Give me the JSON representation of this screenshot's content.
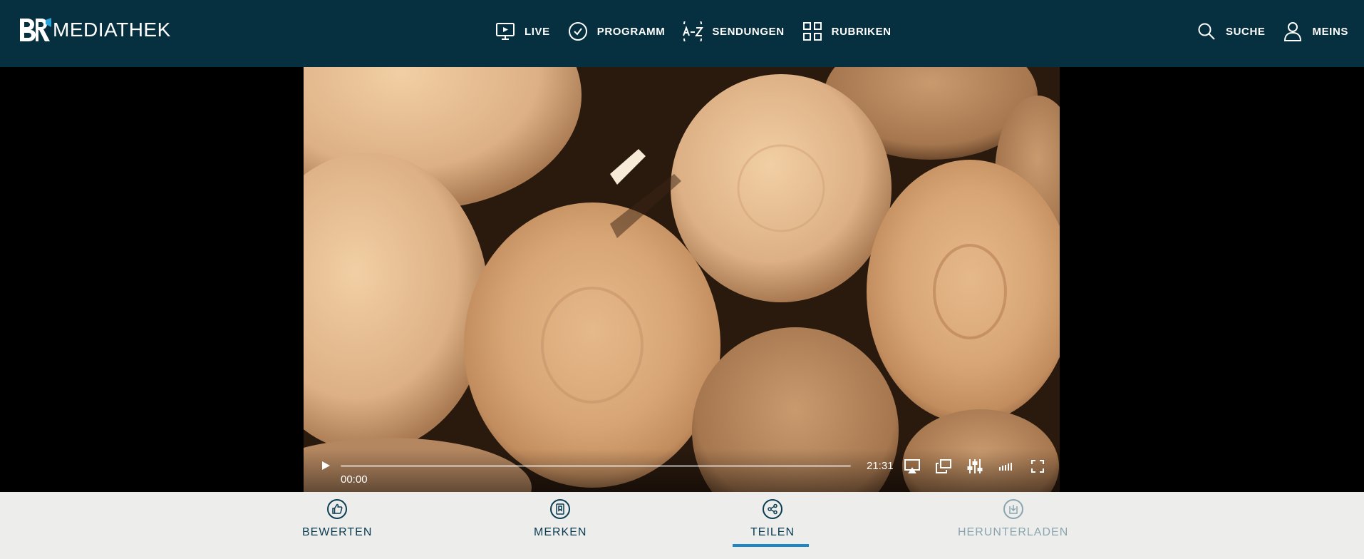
{
  "header": {
    "logo_text": "MEDIATHEK",
    "nav": [
      {
        "label": "LIVE",
        "icon": "live-tv-icon"
      },
      {
        "label": "PROGRAMM",
        "icon": "clock-icon"
      },
      {
        "label": "SENDUNGEN",
        "icon": "a-z-icon"
      },
      {
        "label": "RUBRIKEN",
        "icon": "grid-icon"
      }
    ],
    "search_label": "SUCHE",
    "account_label": "MEINS"
  },
  "player": {
    "current_time": "00:00",
    "duration": "21:31",
    "progress_fraction": 0.0,
    "controls": [
      "play-icon",
      "airplay-icon",
      "picture-in-picture-icon",
      "settings-sliders-icon",
      "volume-icon",
      "fullscreen-icon"
    ]
  },
  "actions": [
    {
      "label": "BEWERTEN",
      "icon": "thumbs-up-icon",
      "enabled": true
    },
    {
      "label": "MERKEN",
      "icon": "bookmark-icon",
      "enabled": true
    },
    {
      "label": "TEILEN",
      "icon": "share-icon",
      "enabled": true,
      "active": true
    },
    {
      "label": "HERUNTERLADEN",
      "icon": "download-icon",
      "enabled": false
    }
  ],
  "colors": {
    "header_bg": "#06303f",
    "action_bar_bg": "#ededeb",
    "action_text": "#0b3d52",
    "active_indicator": "#1c86c6"
  }
}
